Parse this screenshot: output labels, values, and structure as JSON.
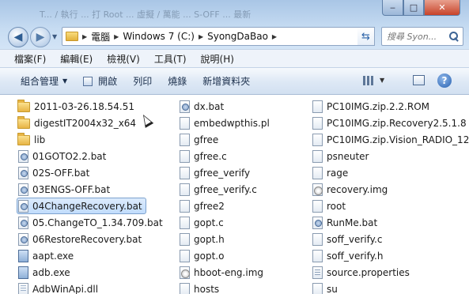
{
  "window": {
    "title_faded": "T... / 執行 ... 打 Root ... 虛擬 / 萬能 ... S-OFF ... 最新"
  },
  "address": {
    "crumbs": [
      "電腦",
      "Windows 7 (C:)",
      "SyongDaBao"
    ]
  },
  "search": {
    "placeholder": "搜尋 Syon..."
  },
  "menu": [
    "檔案(F)",
    "編輯(E)",
    "檢視(V)",
    "工具(T)",
    "說明(H)"
  ],
  "toolbar": {
    "organize": "組合管理",
    "open": "開啟",
    "print": "列印",
    "burn": "燒錄",
    "new_folder": "新增資料夾"
  },
  "files": {
    "col1": [
      {
        "name": "2011-03-26.18.54.51",
        "icon": "folder-icon"
      },
      {
        "name": "digestIT2004x32_x64",
        "icon": "folder-icon"
      },
      {
        "name": "lib",
        "icon": "folder-icon"
      },
      {
        "name": "01GOTO2.2.bat",
        "icon": "bat-icon"
      },
      {
        "name": "02S-OFF.bat",
        "icon": "bat-icon"
      },
      {
        "name": "03ENGS-OFF.bat",
        "icon": "bat-icon"
      },
      {
        "name": "04ChangeRecovery.bat",
        "icon": "bat-icon",
        "selected": true
      },
      {
        "name": "05.ChangeTO_1.34.709.bat",
        "icon": "bat-icon"
      },
      {
        "name": "06RestoreRecovery.bat",
        "icon": "bat-icon"
      },
      {
        "name": "aapt.exe",
        "icon": "exe-icon"
      },
      {
        "name": "adb.exe",
        "icon": "exe-icon"
      },
      {
        "name": "AdbWinApi.dll",
        "icon": "dll-icon"
      }
    ],
    "col2": [
      {
        "name": "dx.bat",
        "icon": "bat-icon"
      },
      {
        "name": "embedwpthis.pl",
        "icon": "file-icon"
      },
      {
        "name": "gfree",
        "icon": "file-icon"
      },
      {
        "name": "gfree.c",
        "icon": "file-icon"
      },
      {
        "name": "gfree_verify",
        "icon": "file-icon"
      },
      {
        "name": "gfree_verify.c",
        "icon": "file-icon"
      },
      {
        "name": "gfree2",
        "icon": "file-icon"
      },
      {
        "name": "gopt.c",
        "icon": "file-icon"
      },
      {
        "name": "gopt.h",
        "icon": "file-icon"
      },
      {
        "name": "gopt.o",
        "icon": "file-icon"
      },
      {
        "name": "hboot-eng.img",
        "icon": "img-icon"
      },
      {
        "name": "hosts",
        "icon": "file-icon"
      }
    ],
    "col3": [
      {
        "name": "PC10IMG.zip.2.2.ROM",
        "icon": "file-icon"
      },
      {
        "name": "PC10IMG.zip.Recovery2.5.1.8",
        "icon": "file-icon"
      },
      {
        "name": "PC10IMG.zip.Vision_RADIO_12",
        "icon": "file-icon"
      },
      {
        "name": "psneuter",
        "icon": "file-icon"
      },
      {
        "name": "rage",
        "icon": "file-icon"
      },
      {
        "name": "recovery.img",
        "icon": "img-icon"
      },
      {
        "name": "root",
        "icon": "file-icon"
      },
      {
        "name": "RunMe.bat",
        "icon": "bat-icon"
      },
      {
        "name": "soff_verify.c",
        "icon": "file-icon"
      },
      {
        "name": "soff_verify.h",
        "icon": "file-icon"
      },
      {
        "name": "source.properties",
        "icon": "txt-icon"
      },
      {
        "name": "su",
        "icon": "file-icon"
      }
    ]
  }
}
